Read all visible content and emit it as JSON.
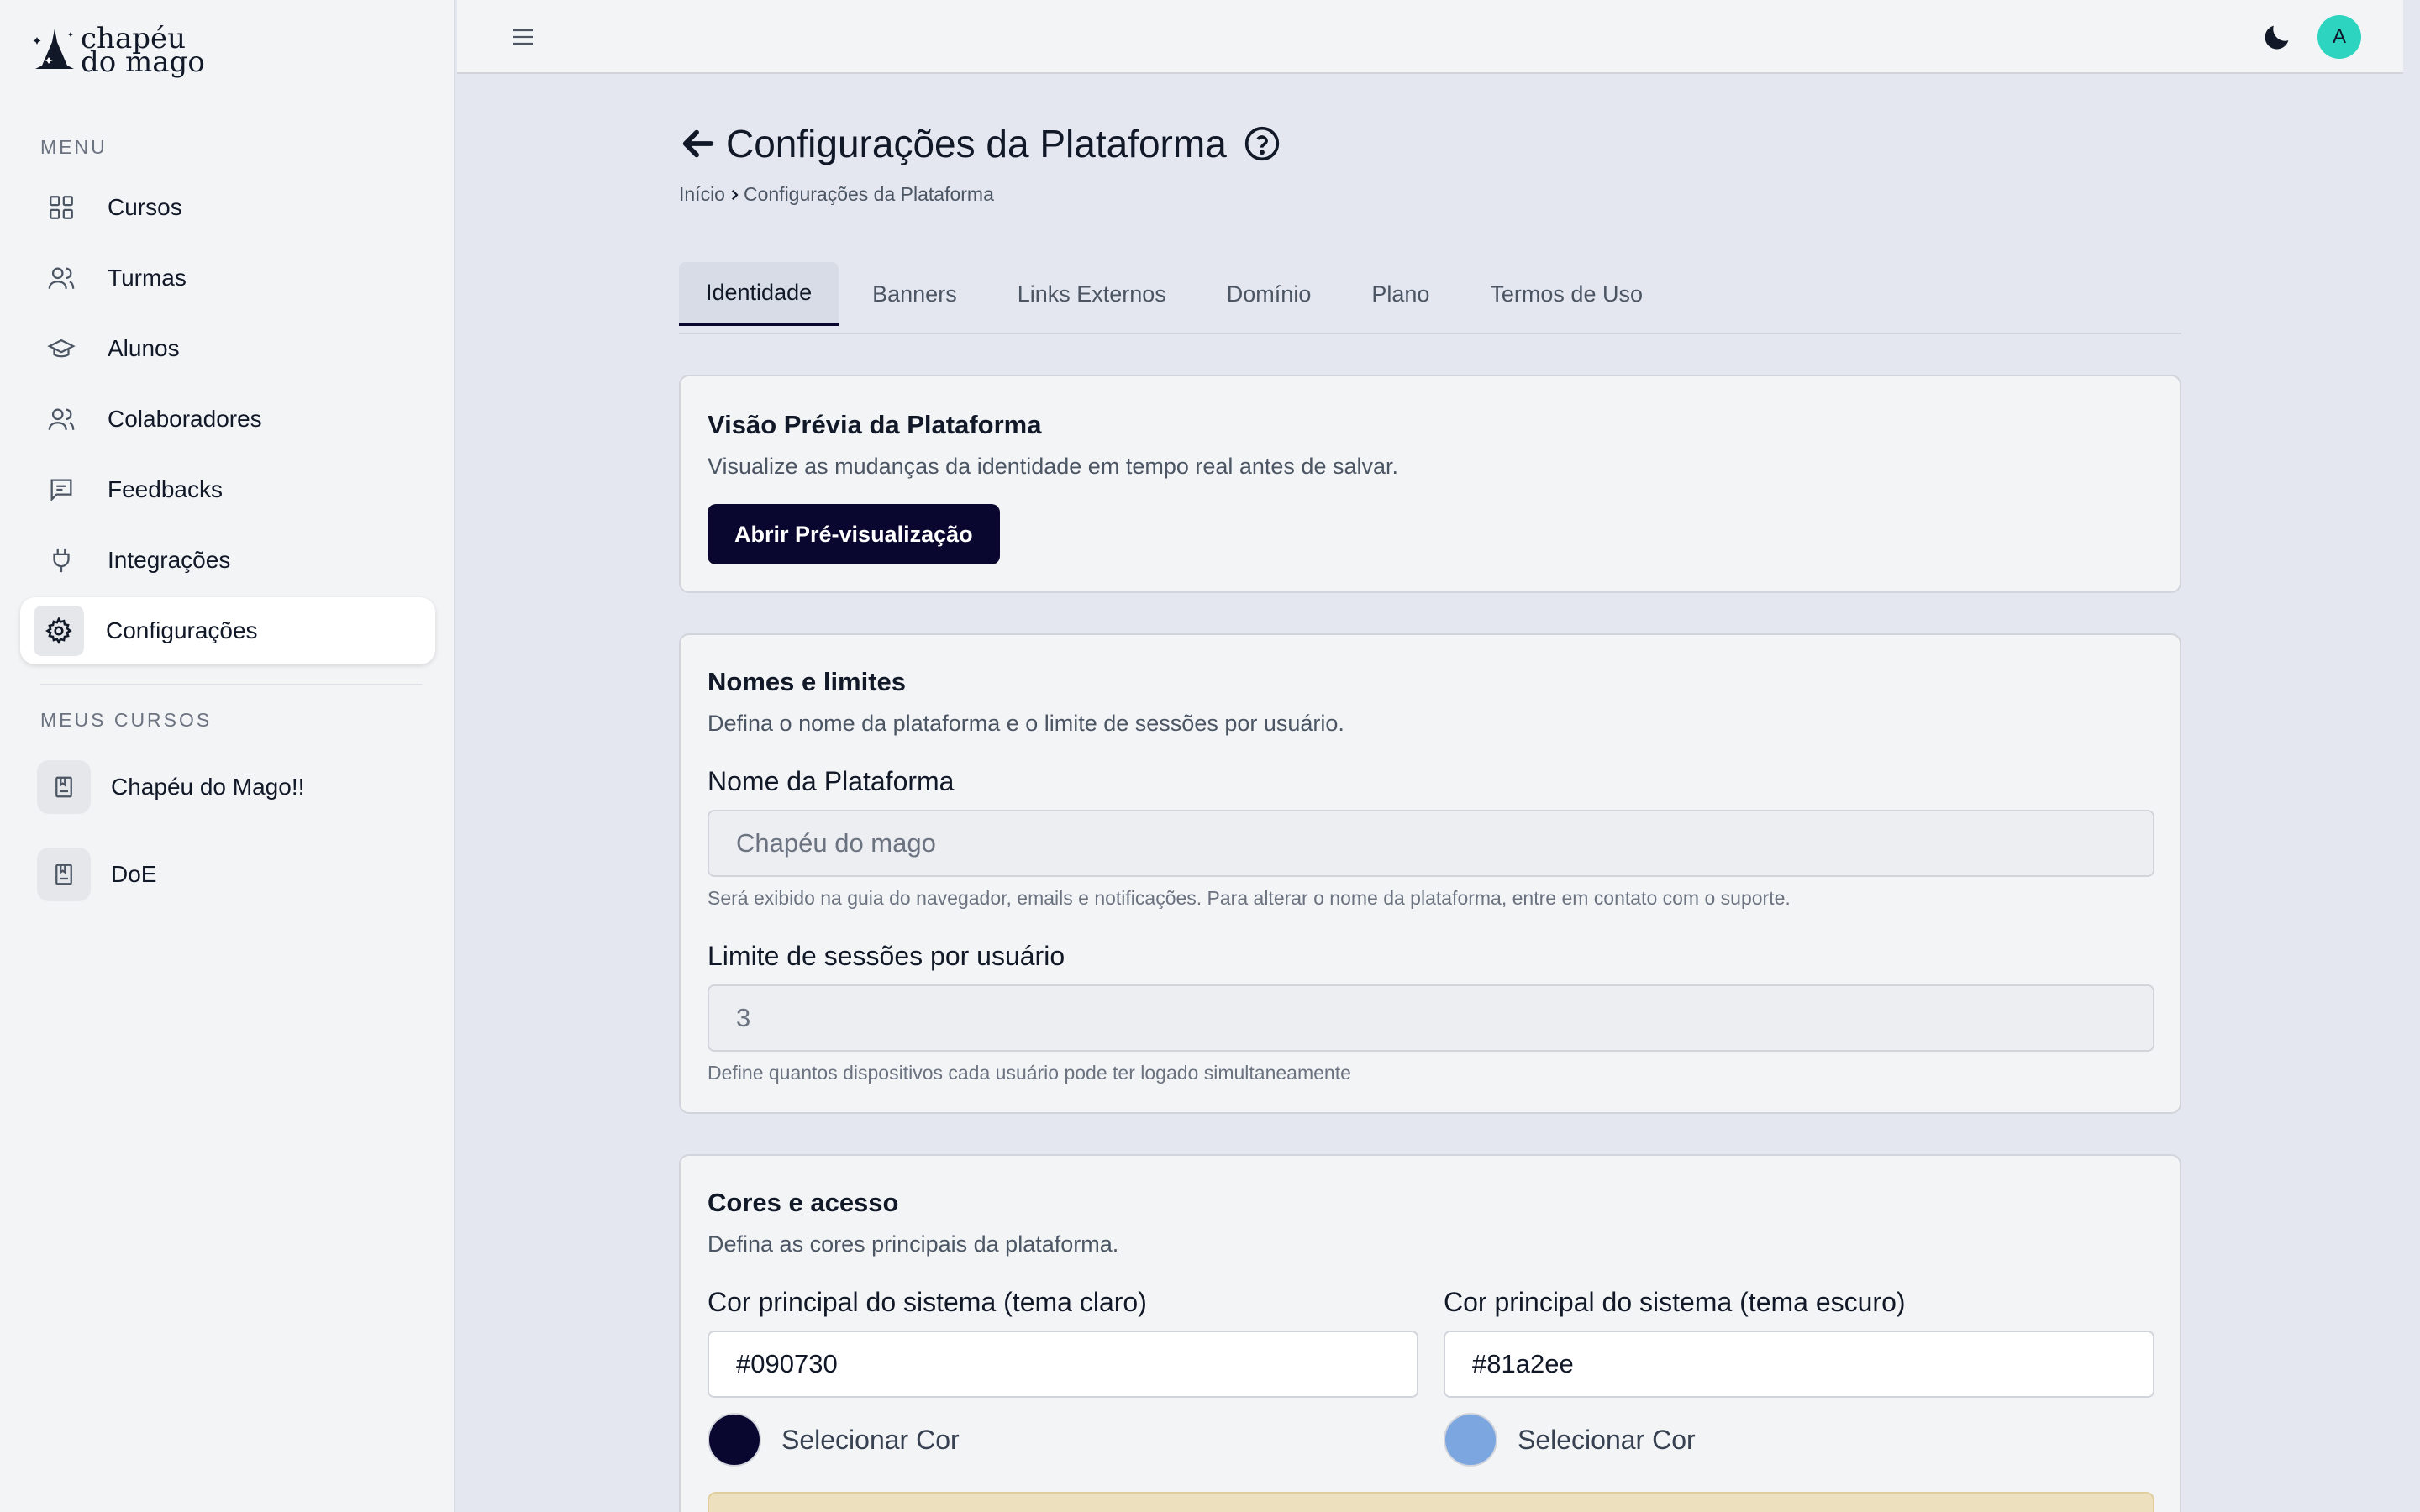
{
  "brand": {
    "line1": "chapéu",
    "line2": "do mago"
  },
  "sidebar": {
    "menu_label": "MENU",
    "items": [
      {
        "label": "Cursos",
        "icon": "grid-icon"
      },
      {
        "label": "Turmas",
        "icon": "users-icon"
      },
      {
        "label": "Alunos",
        "icon": "graduation-cap-icon"
      },
      {
        "label": "Colaboradores",
        "icon": "team-icon"
      },
      {
        "label": "Feedbacks",
        "icon": "message-icon"
      },
      {
        "label": "Integrações",
        "icon": "plug-icon"
      },
      {
        "label": "Configurações",
        "icon": "gear-icon",
        "active": true
      }
    ],
    "courses_label": "MEUS CURSOS",
    "courses": [
      {
        "label": "Chapéu do Mago!!",
        "icon": "book-icon"
      },
      {
        "label": "DoE",
        "icon": "book-icon"
      }
    ]
  },
  "topbar": {
    "avatar_initial": "A",
    "avatar_color": "#2dd4bf"
  },
  "page": {
    "title": "Configurações da Plataforma",
    "breadcrumb": {
      "home": "Início",
      "current": "Configurações da Plataforma"
    }
  },
  "tabs": [
    {
      "label": "Identidade",
      "active": true
    },
    {
      "label": "Banners"
    },
    {
      "label": "Links Externos"
    },
    {
      "label": "Domínio"
    },
    {
      "label": "Plano"
    },
    {
      "label": "Termos de Uso"
    }
  ],
  "preview_card": {
    "title": "Visão Prévia da Plataforma",
    "subtitle": "Visualize as mudanças da identidade em tempo real antes de salvar.",
    "button": "Abrir Pré-visualização"
  },
  "names_card": {
    "title": "Nomes e limites",
    "subtitle": "Defina o nome da plataforma e o limite de sessões por usuário.",
    "platform_name_label": "Nome da Plataforma",
    "platform_name_value": "Chapéu do mago",
    "platform_name_help": "Será exibido na guia do navegador, emails e notificações. Para alterar o nome da plataforma, entre em contato com o suporte.",
    "sessions_label": "Limite de sessões por usuário",
    "sessions_value": "3",
    "sessions_help": "Define quantos dispositivos cada usuário pode ter logado simultaneamente"
  },
  "colors_card": {
    "title": "Cores e acesso",
    "subtitle": "Defina as cores principais da plataforma.",
    "light_label": "Cor principal do sistema (tema claro)",
    "light_value": "#090730",
    "dark_label": "Cor principal do sistema (tema escuro)",
    "dark_value": "#81a2ee",
    "select_color": "Selecionar Cor",
    "swatch_light": "#090730",
    "swatch_dark": "#7ba6e0"
  }
}
